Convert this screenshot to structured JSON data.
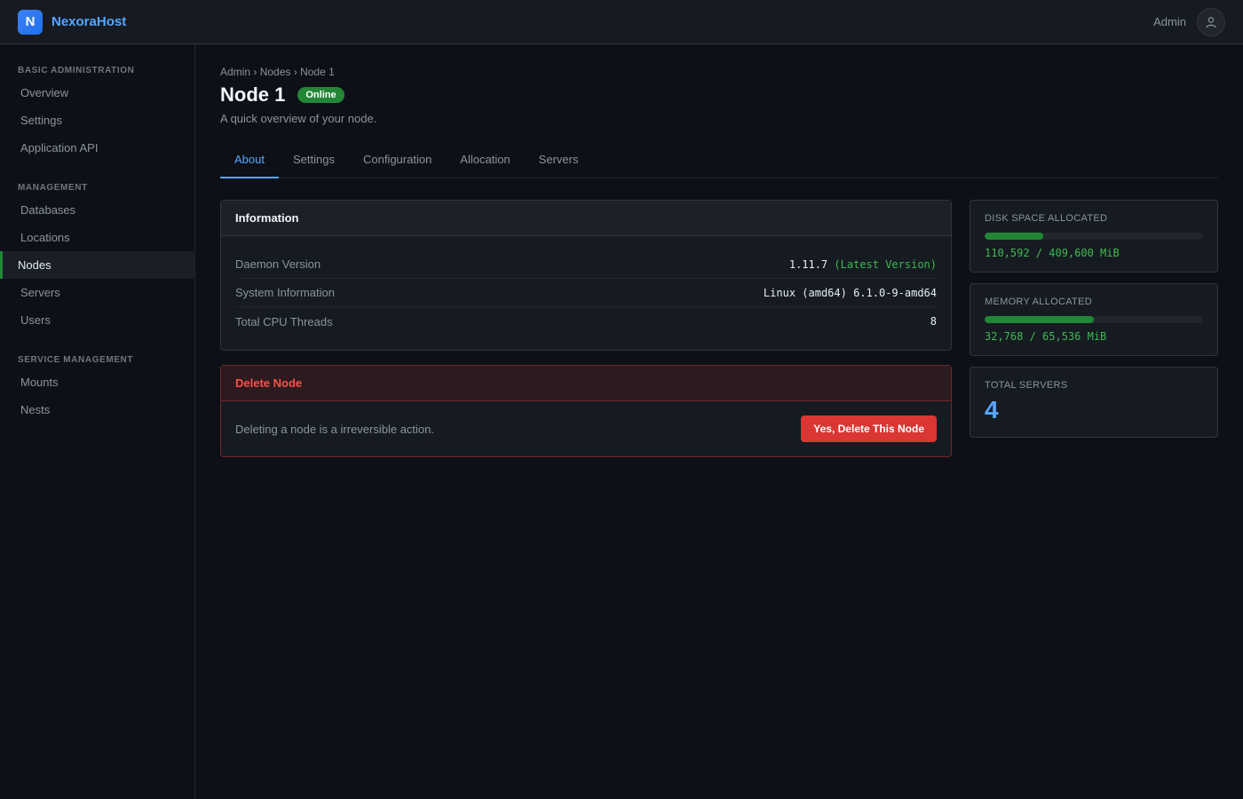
{
  "header": {
    "logo_letter": "N",
    "brand": "NexoraHost",
    "user": "Admin",
    "avatar_icon": "user-icon"
  },
  "sidebar": {
    "sections": [
      {
        "title": "Basic Administration",
        "items": [
          "Overview",
          "Settings",
          "Application API"
        ]
      },
      {
        "title": "Management",
        "items": [
          "Databases",
          "Locations",
          "Nodes",
          "Servers",
          "Users"
        ]
      },
      {
        "title": "Service Management",
        "items": [
          "Mounts",
          "Nests"
        ]
      }
    ],
    "active_item": "Nodes"
  },
  "breadcrumb": {
    "items": [
      "Admin",
      "Nodes",
      "Node 1"
    ],
    "separator": "›"
  },
  "page": {
    "title": "Node 1",
    "status": "Online",
    "subtitle": "A quick overview of your node."
  },
  "tabs": {
    "items": [
      "About",
      "Settings",
      "Configuration",
      "Allocation",
      "Servers"
    ],
    "active": "About"
  },
  "information": {
    "title": "Information",
    "rows": [
      {
        "label": "Daemon Version",
        "value": "1.11.7",
        "note": "(Latest Version)"
      },
      {
        "label": "System Information",
        "value": "Linux (amd64) 6.1.0-9-amd64"
      },
      {
        "label": "Total CPU Threads",
        "value": "8"
      }
    ]
  },
  "delete_node": {
    "title": "Delete Node",
    "text": "Deleting a node is a irreversible action.",
    "button": "Yes, Delete This Node"
  },
  "stats": {
    "disk": {
      "label": "Disk Space Allocated",
      "value": "110,592 / 409,600 MiB",
      "percent": 27
    },
    "memory": {
      "label": "Memory Allocated",
      "value": "32,768 / 65,536 MiB",
      "percent": 50
    },
    "servers": {
      "label": "Total Servers",
      "value": "4"
    }
  },
  "colors": {
    "accent": "#58a6ff",
    "success": "#238636",
    "danger": "#da3633"
  }
}
